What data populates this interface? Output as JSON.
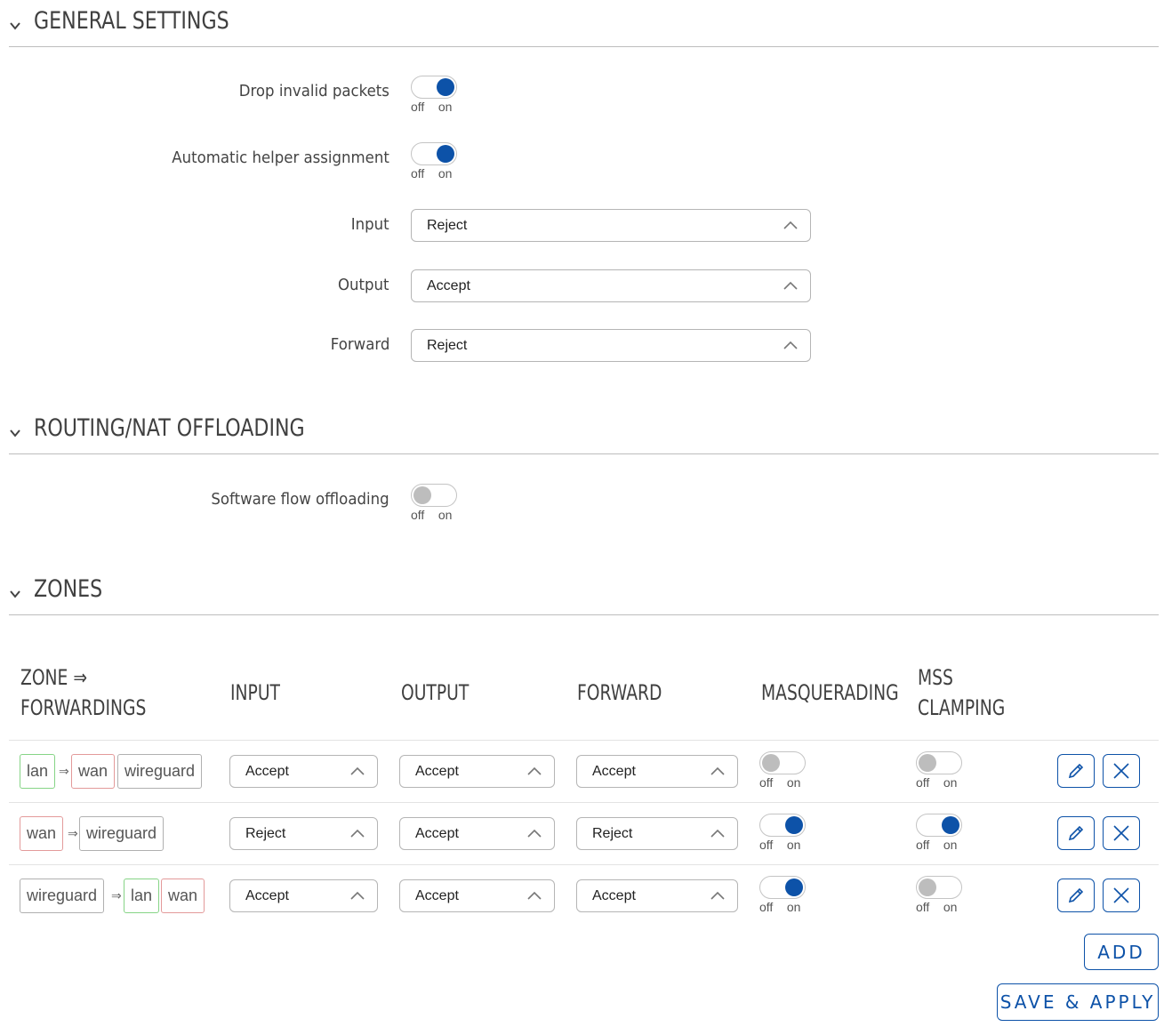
{
  "sections": {
    "general": {
      "title": "GENERAL SETTINGS"
    },
    "routing": {
      "title": "ROUTING/NAT OFFLOADING"
    },
    "zones": {
      "title": "ZONES"
    }
  },
  "general": {
    "drop_invalid": {
      "label": "Drop invalid packets",
      "state": "on"
    },
    "auto_helper": {
      "label": "Automatic helper assignment",
      "state": "on"
    },
    "input": {
      "label": "Input",
      "value": "Reject"
    },
    "output": {
      "label": "Output",
      "value": "Accept"
    },
    "forward": {
      "label": "Forward",
      "value": "Reject"
    }
  },
  "routing": {
    "sw_offload": {
      "label": "Software flow offloading",
      "state": "off"
    }
  },
  "toggle_labels": {
    "off": "off",
    "on": "on"
  },
  "zones": {
    "headers": {
      "zone_line1": "ZONE ⇒",
      "zone_line2": "FORWARDINGS",
      "input": "INPUT",
      "output": "OUTPUT",
      "forward": "FORWARD",
      "masquerading": "MASQUERADING",
      "mss_line1": "MSS",
      "mss_line2": "CLAMPING"
    },
    "arrow": "⇒",
    "rows": [
      {
        "zone": "lan",
        "forwards": [
          "wan",
          "wireguard"
        ],
        "input": "Accept",
        "output": "Accept",
        "forward": "Accept",
        "masquerading": "off",
        "mss": "off"
      },
      {
        "zone": "wan",
        "forwards": [
          "wireguard"
        ],
        "input": "Reject",
        "output": "Accept",
        "forward": "Reject",
        "masquerading": "on",
        "mss": "on"
      },
      {
        "zone": "wireguard",
        "forwards": [
          "lan",
          "wan"
        ],
        "input": "Accept",
        "output": "Accept",
        "forward": "Accept",
        "masquerading": "on",
        "mss": "off"
      }
    ]
  },
  "buttons": {
    "add": "ADD",
    "save_apply": "SAVE & APPLY"
  },
  "colors": {
    "accent": "#0d52a8",
    "toggle_off": "#bdbdbd",
    "tag_lan": "#86d486",
    "tag_wan": "#e39a9a",
    "tag_wireguard": "#b0b0b0"
  }
}
